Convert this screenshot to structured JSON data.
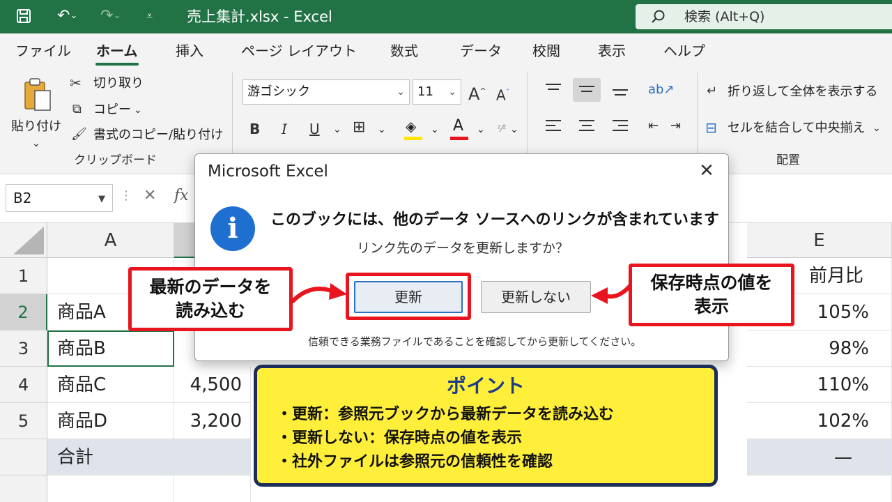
{
  "titlebar": {
    "title": "売上集計.xlsx  -  Excel",
    "search_placeholder": "検索 (Alt+Q)",
    "save_icon": "save-icon",
    "undo_icon": "undo-icon",
    "redo_icon": "redo-icon",
    "customize_icon": "customize-qat-icon",
    "bg_color": "#217346"
  },
  "tabs": [
    {
      "label": "ファイル"
    },
    {
      "label": "ホーム",
      "active": true
    },
    {
      "label": "挿入"
    },
    {
      "label": "ページ レイアウト"
    },
    {
      "label": "数式"
    },
    {
      "label": "データ"
    },
    {
      "label": "校閲"
    },
    {
      "label": "表示"
    },
    {
      "label": "ヘルプ"
    }
  ],
  "ribbon": {
    "clipboard": {
      "paste_label": "貼り付け",
      "cut_label": "切り取り",
      "copy_label": "コピー",
      "format_painter_label": "書式のコピー/貼り付け",
      "group_label": "クリップボード"
    },
    "font": {
      "font_name": "游ゴシック",
      "font_size": "11",
      "increase_font": "A",
      "decrease_font": "A",
      "bold": "B",
      "italic": "I",
      "underline": "U",
      "font_color_letter": "A"
    },
    "alignment": {
      "wrap_text_label": "折り返して全体を表示する",
      "merge_center_label": "セルを結合して中央揃え",
      "group_label": "配置"
    }
  },
  "formula_bar": {
    "name_box": "B2",
    "cancel_symbol": "✕",
    "fx_label": "fx"
  },
  "grid": {
    "columns": [
      "A",
      "E"
    ],
    "rows": [
      "1",
      "2",
      "3",
      "4",
      "5"
    ],
    "cells": {
      "A2": "商品A",
      "A3": "商品B",
      "A4": "商品C",
      "A5": "商品D",
      "A6": "合計",
      "B4": "4,500",
      "B5": "3,200",
      "E1": "前月比",
      "E2": "105%",
      "E3": "98%",
      "E4": "110%",
      "E5": "102%",
      "E6": "—"
    }
  },
  "dialog": {
    "title": "Microsoft Excel",
    "main_message": "このブックには、他のデータ ソースへのリンクが含まれています",
    "sub_message": "リンク先のデータを更新しますか？",
    "update_button": "更新",
    "no_update_button": "更新しない",
    "note": "信頼できる業務ファイルであることを確認してから更新してください。",
    "info_glyph": "i"
  },
  "callouts": {
    "left": [
      "最新のデータを",
      "読み込む"
    ],
    "right": [
      "保存時点の値を",
      "表示"
    ],
    "highlight_color": "#e8141e"
  },
  "point": {
    "title": "ポイント",
    "items": [
      "・更新：参照元ブックから最新データを読み込む",
      "・更新しない：保存時点の値を表示",
      "・社外ファイルは参照元の信頼性を確認"
    ],
    "bg_color": "#ffef3a",
    "border_color": "#1c2d5a"
  }
}
